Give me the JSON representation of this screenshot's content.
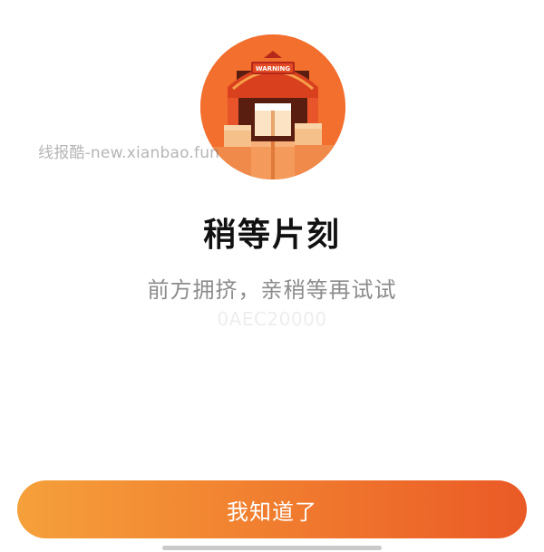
{
  "illustration": {
    "sign_text": "WARNING",
    "icon": "warning-storefront-illustration"
  },
  "watermark": {
    "text": "线报酷-new.xianbao.fun"
  },
  "dialog": {
    "title": "稍等片刻",
    "message": "前方拥挤，亲稍等再试试",
    "error_code": "0AEC20000"
  },
  "actions": {
    "confirm_label": "我知道了"
  },
  "colors": {
    "accent_start": "#f5a03b",
    "accent_end": "#ea5a26",
    "title": "#111111",
    "message": "#8c8c8c"
  }
}
